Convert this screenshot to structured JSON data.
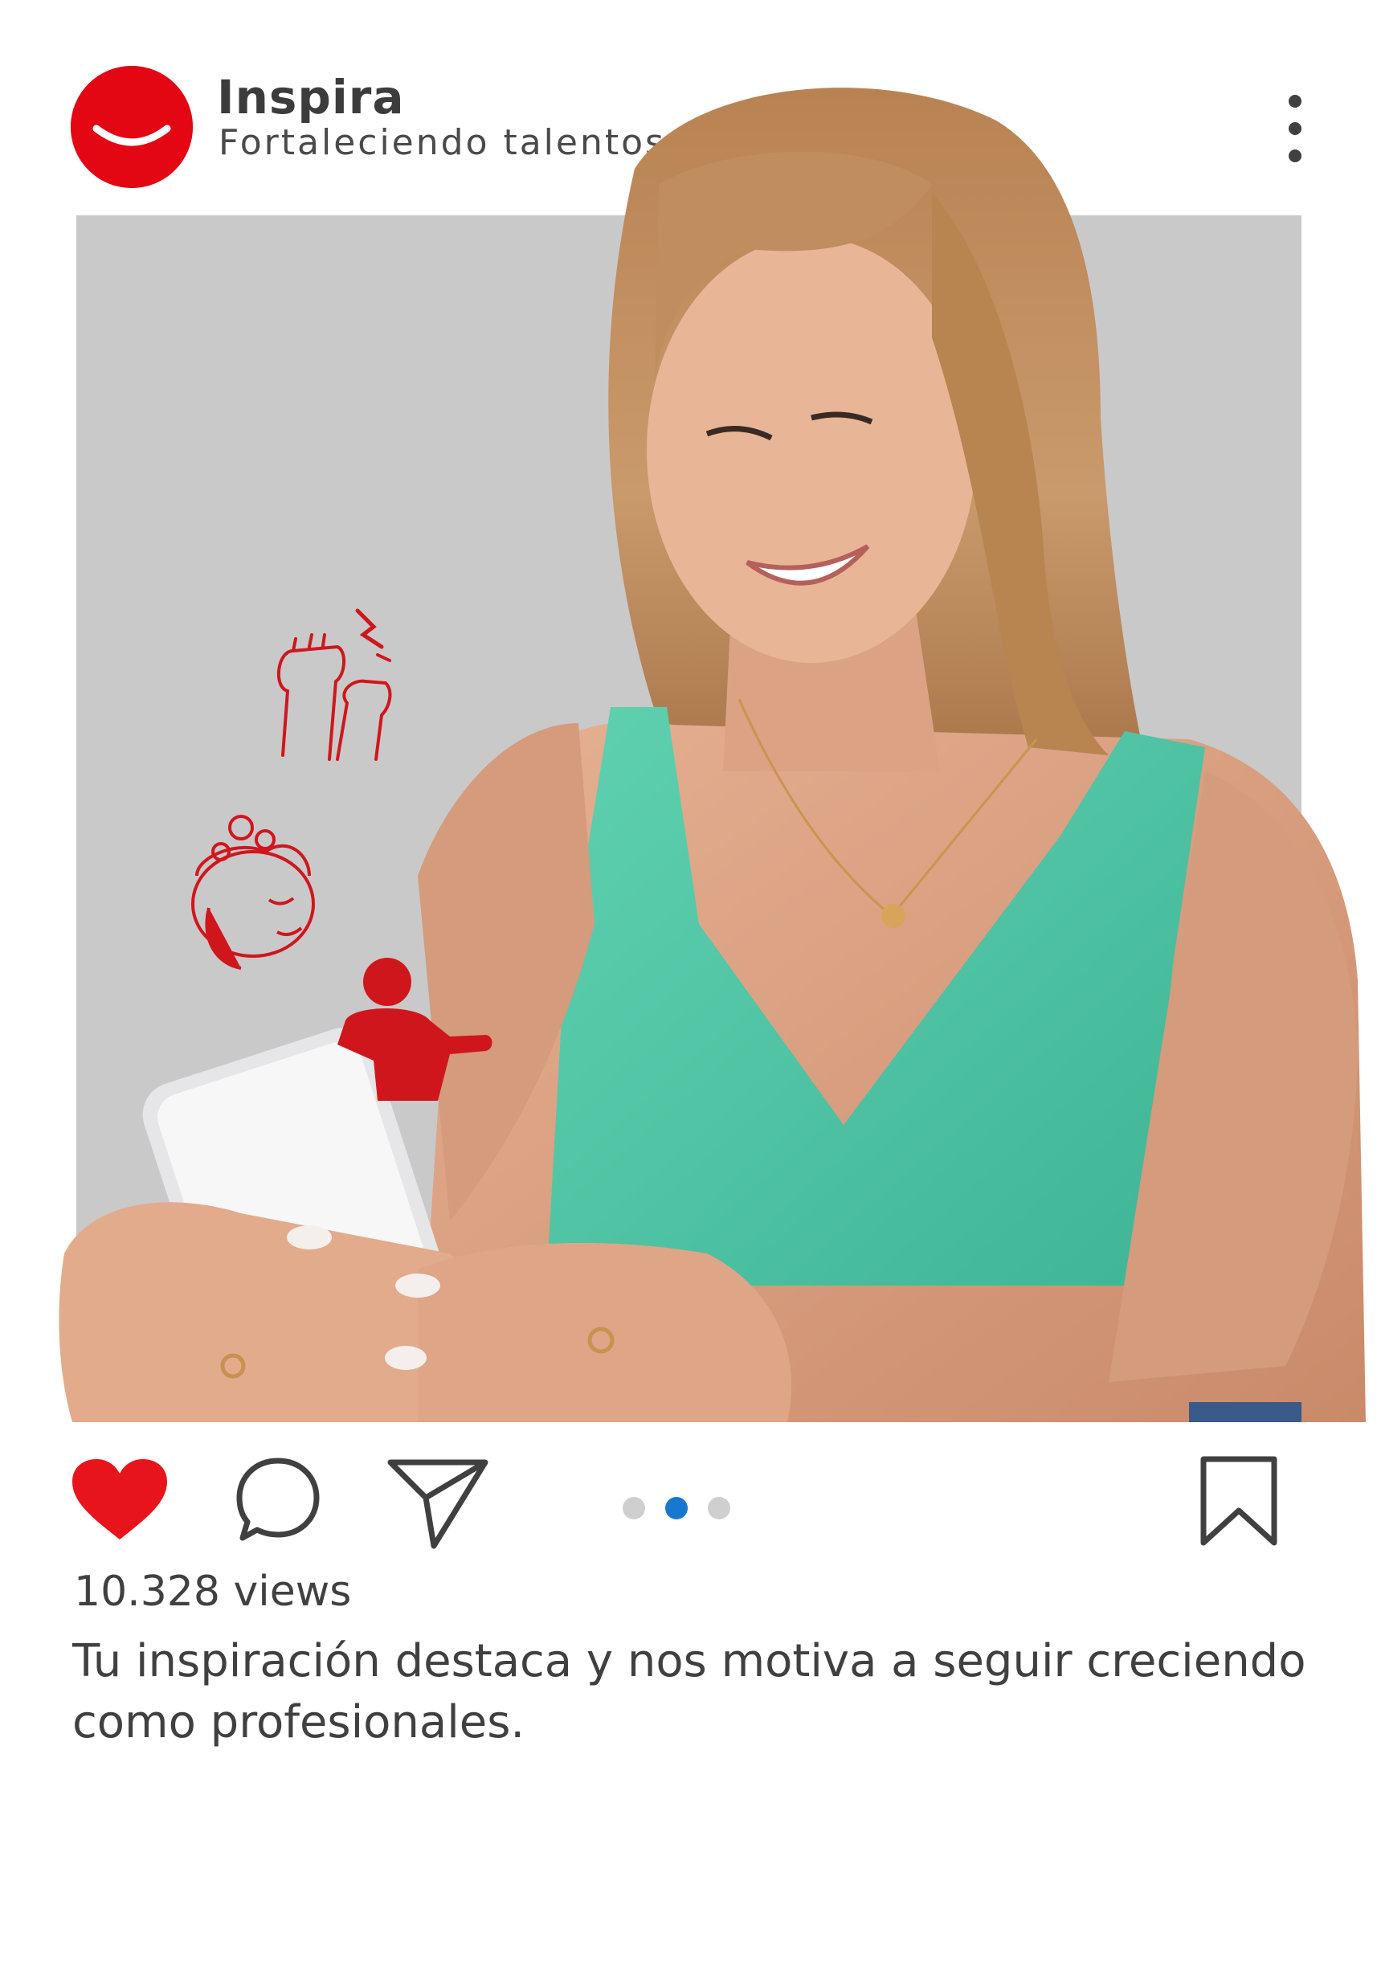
{
  "account": {
    "name": "Inspira",
    "tagline": "Fortaleciendo talentos",
    "brand_color": "#e30613"
  },
  "post": {
    "image_description_icons": [
      "raised-fists-icon",
      "open-mind-icon",
      "superhero-icon",
      "woman-using-phone"
    ],
    "carousel": {
      "total": 3,
      "active_index": 1,
      "active_color": "#1878cf"
    },
    "views": "10.328 views",
    "caption": "Tu inspiración destaca y nos motiva a seguir creciendo como profesionales.",
    "liked": true,
    "like_color": "#e8141c"
  }
}
